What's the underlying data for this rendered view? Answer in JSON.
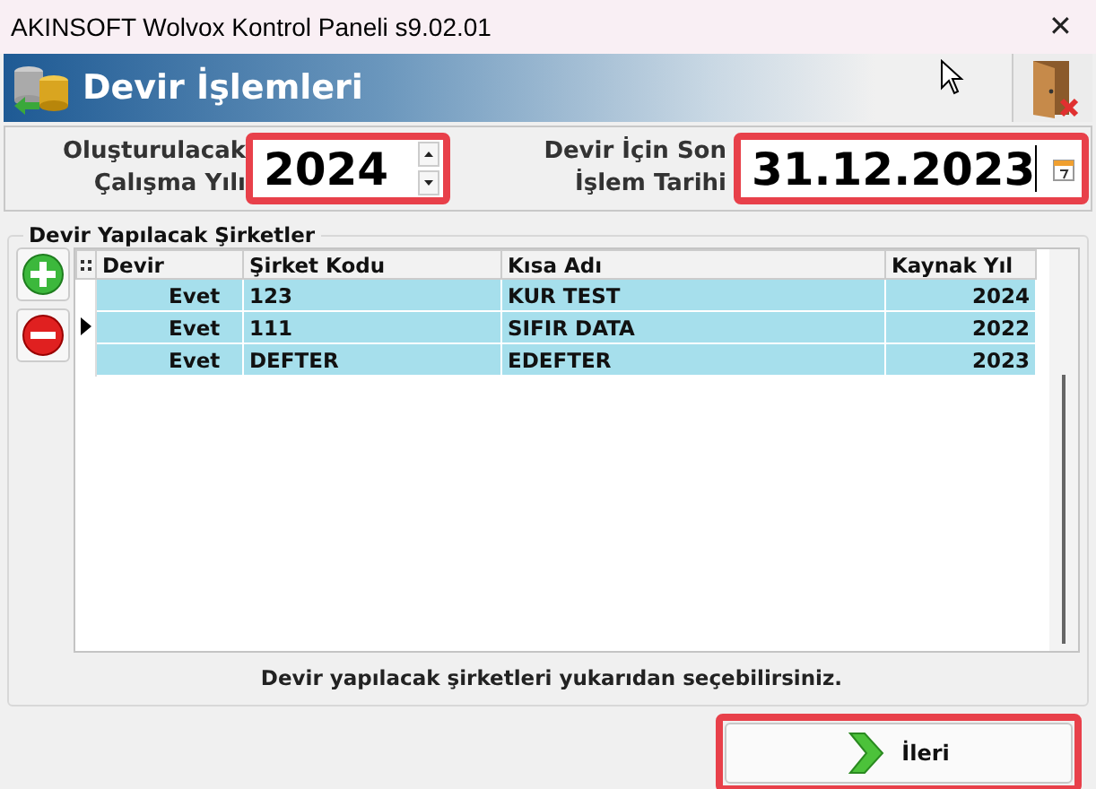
{
  "window": {
    "title": "AKINSOFT Wolvox Kontrol Paneli s9.02.01",
    "close": "✕"
  },
  "header": {
    "title": "Devir İşlemleri"
  },
  "fields": [
    {
      "kind": "spin",
      "label": "Oluşturulacak\nÇalışma Yılı",
      "value": "2024",
      "highlighted": true
    },
    {
      "kind": "date",
      "label": "Devir İçin Son\nİşlem Tarihi",
      "value": "31.12.2023",
      "highlighted": true
    }
  ],
  "group": {
    "title": "Devir Yapılacak Şirketler"
  },
  "table": {
    "columns": [
      "Devir",
      "Şirket Kodu",
      "Kısa Adı",
      "Kaynak Yıl"
    ],
    "rows": [
      {
        "cells": [
          "Evet",
          "123",
          "KUR TEST",
          "2024"
        ],
        "selected": false
      },
      {
        "cells": [
          "Evet",
          "111",
          "SIFIR DATA",
          "2022"
        ],
        "selected": true
      },
      {
        "cells": [
          "Evet",
          "DEFTER",
          "EDEFTER",
          "2023"
        ],
        "selected": false
      }
    ]
  },
  "hint": "Devir yapılacak şirketleri yukarıdan seçebilirsiniz.",
  "next_button": {
    "label": "İleri",
    "highlighted": true
  }
}
